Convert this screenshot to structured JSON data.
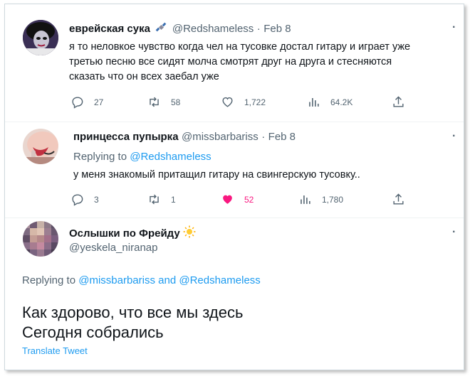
{
  "tweet1": {
    "name": "еврейская сука",
    "handle": "@Redshameless",
    "dot": "·",
    "date": "Feb 8",
    "text_lines": [
      "я то неловкое чувство когда чел на тусовке достал гитару и играет уже",
      "третью песню все сидят молча смотрят друг на друга и стесняются",
      "сказать что он всех заебал уже"
    ],
    "replies": "27",
    "retweets": "58",
    "likes": "1,722",
    "views": "64.2K",
    "more": "·"
  },
  "tweet2": {
    "name": "принцесса пупырка",
    "handle": "@missbarbariss",
    "dot": "·",
    "date": "Feb 8",
    "replying_prefix": "Replying to",
    "replying_handle": "@Redshameless",
    "text": "у меня знакомый притащил гитару на свингерскую тусовку..",
    "replies": "3",
    "retweets": "1",
    "likes": "52",
    "views": "1,780",
    "more": "·"
  },
  "tweet3": {
    "name": "Ослышки по Фрейду",
    "handle": "@yeskela_niranap",
    "replying_prefix": "Replying to",
    "replying_handle1": "@missbarbariss",
    "replying_and": "and",
    "replying_handle2": "@Redshameless",
    "text_lines": [
      "Как здорово, что все мы здесь",
      "Сегодня собрались"
    ],
    "translate": "Translate Tweet",
    "more": "·"
  },
  "colors": {
    "accent": "#1d9bf0",
    "like_active": "#f91880",
    "muted": "#536471"
  },
  "icons": {
    "reply": "reply-icon",
    "retweet": "retweet-icon",
    "like": "heart-icon",
    "views": "views-icon",
    "share": "share-icon",
    "satellite": "satellite-icon",
    "sun": "sun-icon"
  }
}
